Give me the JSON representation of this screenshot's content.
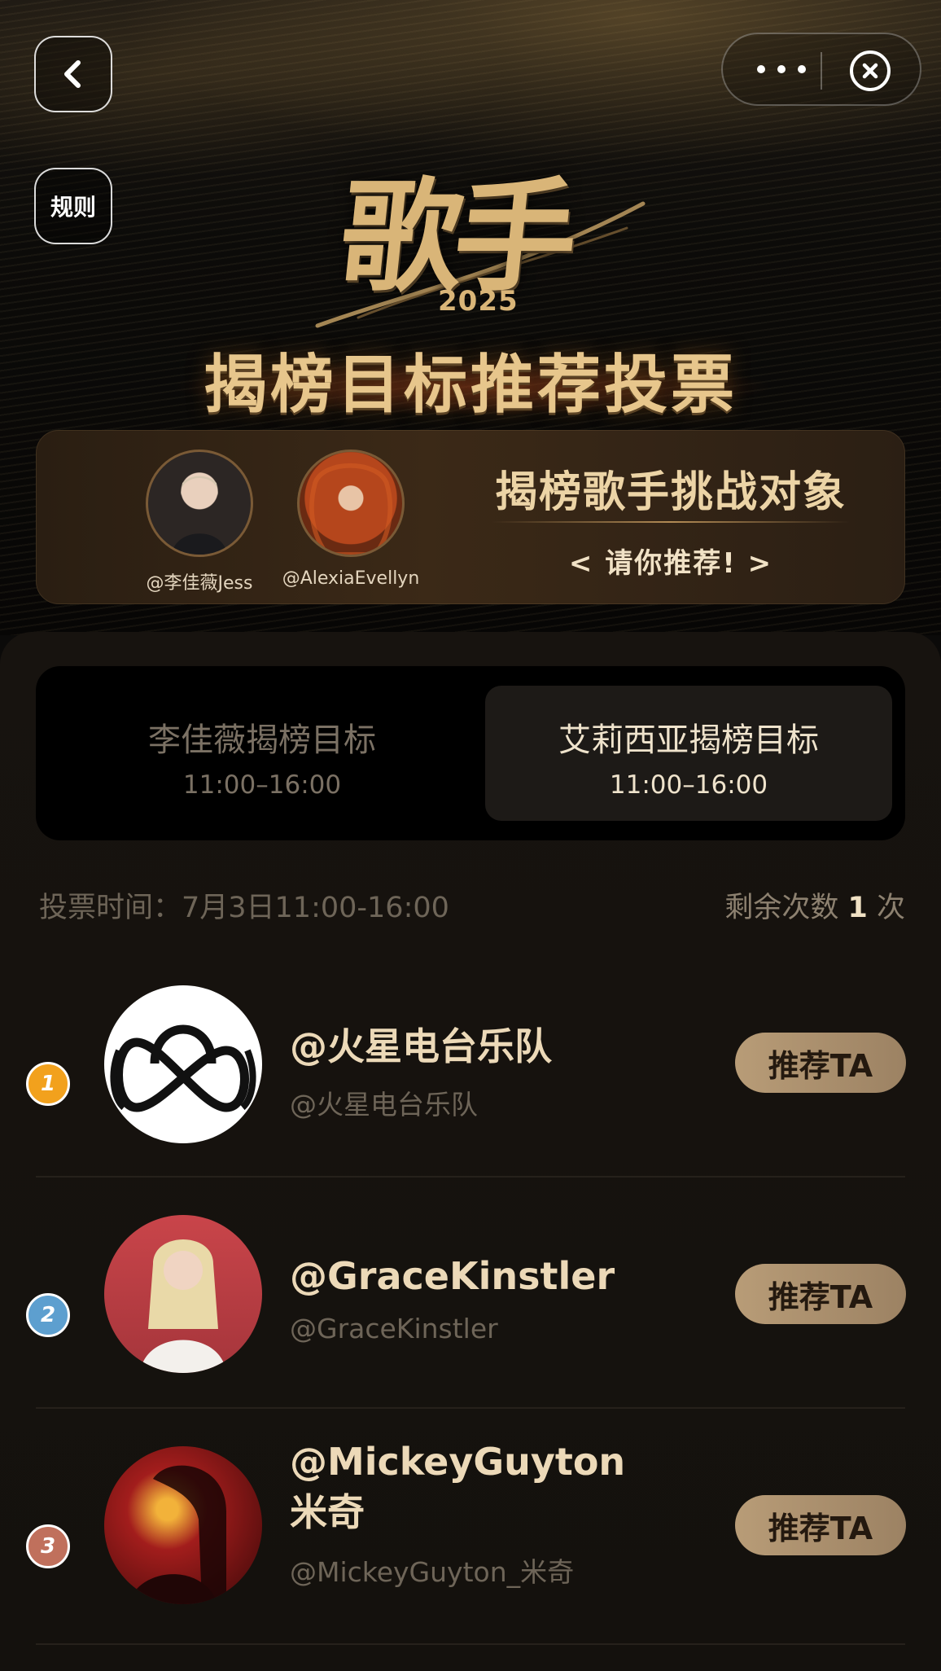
{
  "nav": {
    "rules_label": "规则"
  },
  "banner": {
    "logo_text": "歌手",
    "logo_year": "2025",
    "title": "揭榜目标推荐投票"
  },
  "challenge": {
    "heading": "揭榜歌手挑战对象",
    "subheading": "< 请你推荐! >",
    "challengers": [
      {
        "handle": "@李佳薇Jess"
      },
      {
        "handle": "@AlexiaEvellyn"
      }
    ]
  },
  "tabs": [
    {
      "label": "李佳薇揭榜目标",
      "time": "11:00–16:00",
      "selected": false
    },
    {
      "label": "艾莉西亚揭榜目标",
      "time": "11:00–16:00",
      "selected": true
    }
  ],
  "vote_info": {
    "time_label": "投票时间：7月3日11:00-16:00",
    "remaining_prefix": "剩余次数",
    "remaining_count": "1",
    "remaining_suffix": "次"
  },
  "candidates": [
    {
      "rank": "1",
      "name": "@火星电台乐队",
      "name_line2": "",
      "handle": "@火星电台乐队",
      "button": "推荐TA",
      "rank_color": "#f2a11d"
    },
    {
      "rank": "2",
      "name": "@GraceKinstler",
      "name_line2": "",
      "handle": "@GraceKinstler",
      "button": "推荐TA",
      "rank_color": "#5d9fcf"
    },
    {
      "rank": "3",
      "name": "@MickeyGuyton",
      "name_line2": "米奇",
      "handle": "@MickeyGuyton_米奇",
      "button": "推荐TA",
      "rank_color": "#c0705c"
    }
  ]
}
